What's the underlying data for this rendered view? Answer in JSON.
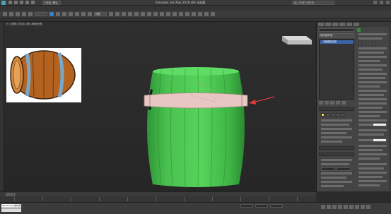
{
  "app": {
    "title": "Autodesk 3ds Max 2018 x64     无标题",
    "workspace": "工作区: 默认",
    "search_placeholder": "键入关键字或短语"
  },
  "toolbar": {
    "view_mode": "视图"
  },
  "viewport": {
    "label": "[+] [透视] [标准] [默认明暗处理]"
  },
  "reference_image": {
    "description_icon": "barrel-reference-image"
  },
  "command_panel": {
    "modifier_list": "修改器列表",
    "stack_item": "可编辑多边形"
  },
  "status": {
    "script_text": "MAXScript 迷你侦听器"
  },
  "colors": {
    "barrel_green": "#49c14f",
    "band_pink": "#e8c6c2",
    "annotation_red": "#e43a3a",
    "selection_yellow": "#e6d23a"
  }
}
